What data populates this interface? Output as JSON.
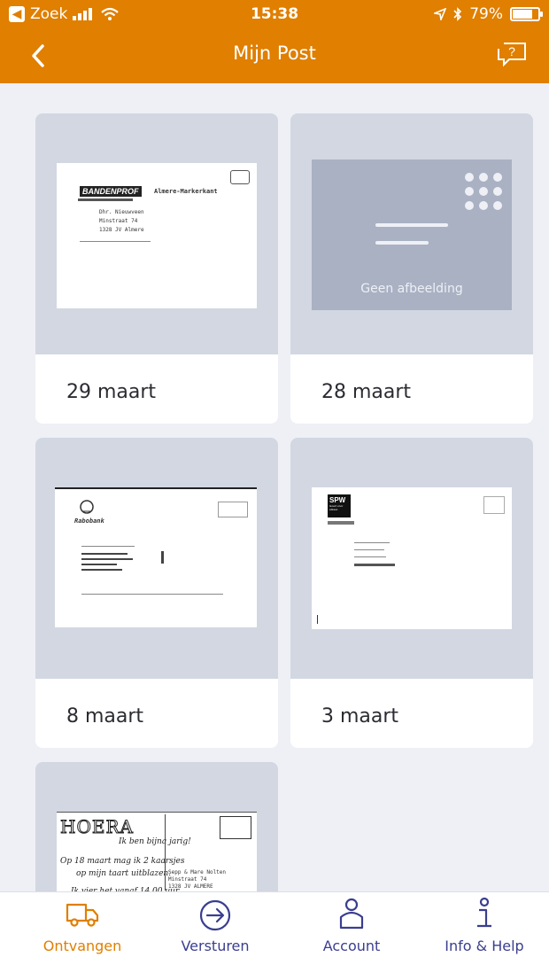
{
  "status_bar": {
    "carrier": "Zoek",
    "time": "15:38",
    "battery": "79%"
  },
  "nav": {
    "title": "Mijn Post"
  },
  "cards": [
    {
      "date": "29 maart",
      "logo": "BANDENPROF",
      "sender": "Almere-Markerkant",
      "addr1": "Dhr. Nieuwveen",
      "addr2": "Minstraat 74",
      "addr3": "1328 JV Almere"
    },
    {
      "date": "28 maart",
      "placeholder": "Geen afbeelding"
    },
    {
      "date": "8 maart",
      "logo": "Rabobank"
    },
    {
      "date": "3 maart",
      "logo": "SPW",
      "sublogo": "Goed voor elkaar."
    },
    {
      "date": "",
      "heading": "HOERA",
      "line1": "Ik ben bijna jarig!",
      "line2": "Op 18 maart mag ik 2 kaarsjes",
      "line3": "op mijn taart uitblazen.",
      "line4": "Ik vier het vanaf 14.00 uur",
      "addr1": "Sepp & Mare Nolten",
      "addr2": "Minstraat 74",
      "addr3": "1328 JV ALMERE"
    }
  ],
  "tabs": [
    {
      "label": "Ontvangen"
    },
    {
      "label": "Versturen"
    },
    {
      "label": "Account"
    },
    {
      "label": "Info & Help"
    }
  ],
  "colors": {
    "brand": "#e07f00",
    "tab_ink": "#3a3e8f"
  }
}
